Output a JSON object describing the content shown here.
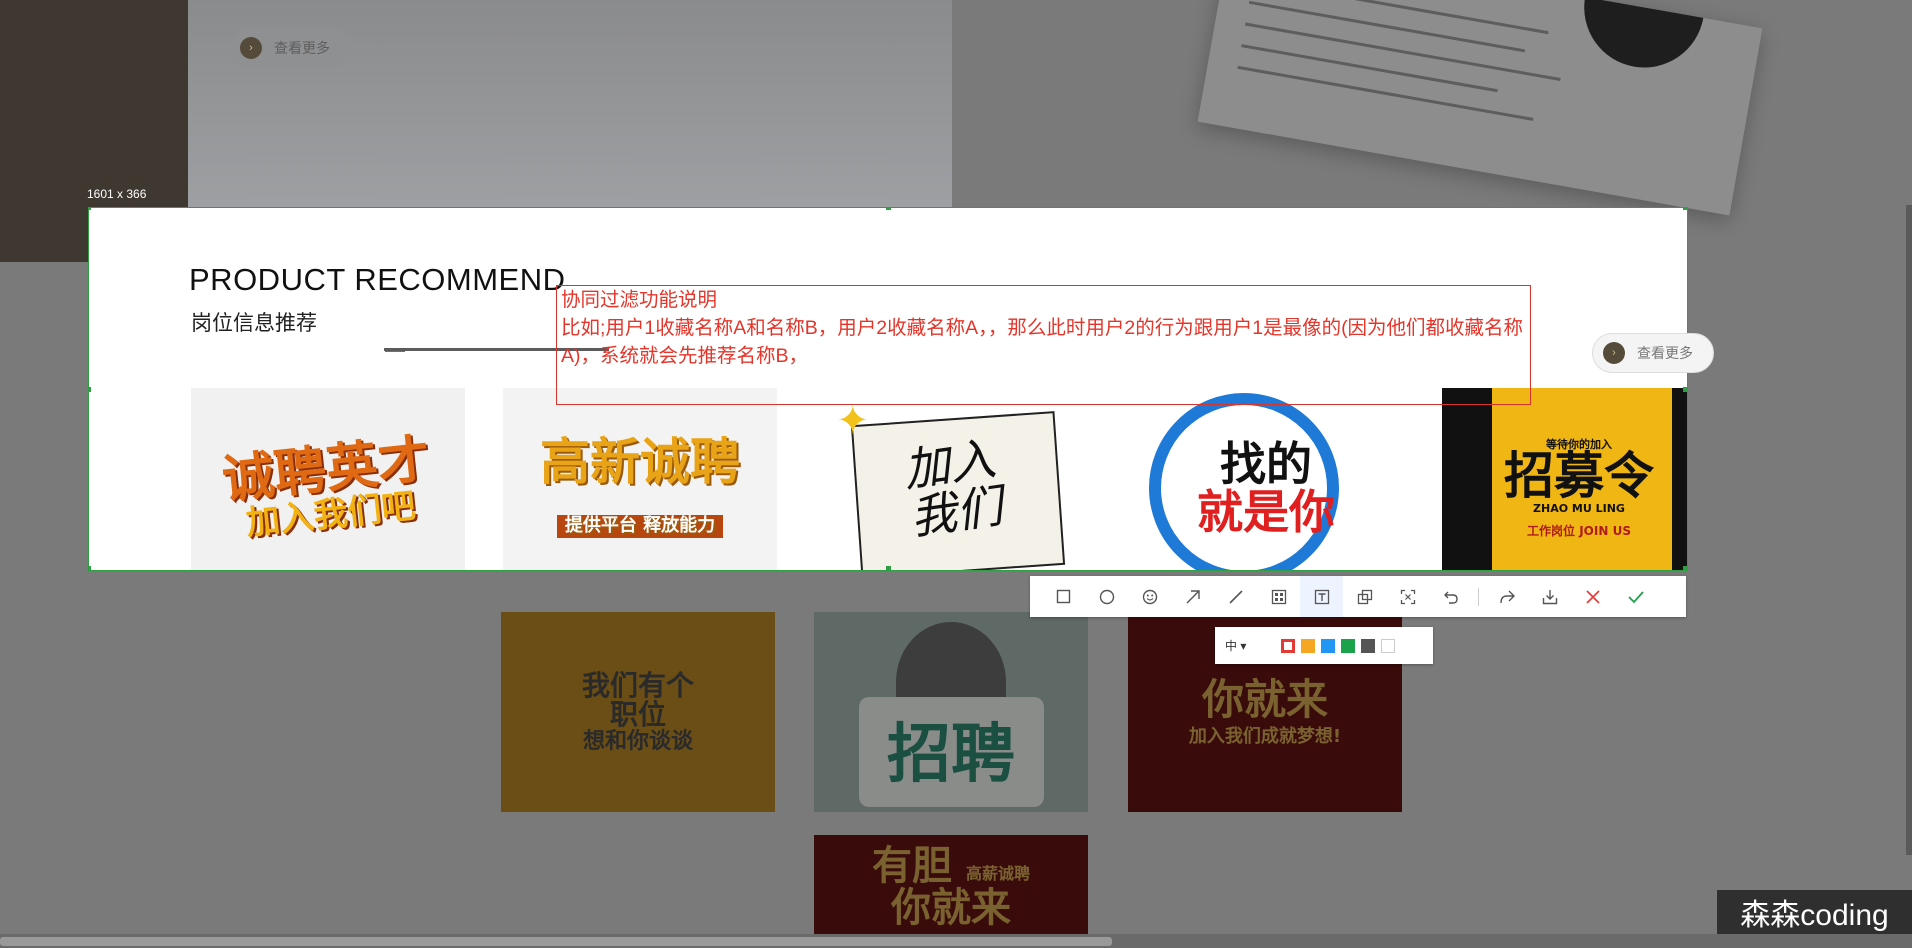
{
  "background": {
    "hero_more_label": "查看更多"
  },
  "capture": {
    "size_label": "1601 x 366"
  },
  "section": {
    "title": "PRODUCT RECOMMEND",
    "subtitle": "岗位信息推荐",
    "more_label": "查看更多"
  },
  "tiles": [
    {
      "lines": [
        "诚聘英才",
        "加入我们吧"
      ]
    },
    {
      "lines": [
        "高新诚聘",
        "提供平台 释放能力"
      ]
    },
    {
      "lines": [
        "加入",
        "我们"
      ]
    },
    {
      "lines": [
        "找的",
        "就是你"
      ]
    },
    {
      "lines": [
        "等待你的加入",
        "招募令",
        "ZHAO MU LING",
        "工作岗位",
        "JOIN US"
      ]
    },
    {
      "lines": [
        "我们有个",
        "职位",
        "想和你谈谈"
      ]
    },
    {
      "lines": [
        "招聘"
      ]
    },
    {
      "lines": [
        "你就来",
        "加入我们成就梦想!"
      ]
    },
    {
      "lines": [
        "有胆",
        "你就来",
        "高薪诚聘"
      ]
    }
  ],
  "note": {
    "title": "协同过滤功能说明",
    "body": "比如;用户1收藏名称A和名称B，用户2收藏名称A，，那么此时用户2的行为跟用户1是最像的(因为他们都收藏名称A)，系统就会先推荐名称B，"
  },
  "toolbar": {
    "icons": [
      "rectangle-icon",
      "ellipse-icon",
      "emoji-icon",
      "arrow-icon",
      "line-icon",
      "mosaic-icon",
      "text-icon",
      "pin-icon",
      "ocr-icon",
      "undo-icon",
      "share-icon",
      "save-icon",
      "cancel-icon",
      "confirm-icon"
    ]
  },
  "color_panel": {
    "size_value": "中",
    "colors": [
      "#e53935",
      "#f5a623",
      "#2196f3",
      "#1aa34a",
      "#555555",
      "#ffffff"
    ],
    "selected_color": "#e53935"
  },
  "watermark": "森森coding",
  "colors": {
    "selection_border": "#2ea043",
    "note_red": "#e4352a"
  }
}
